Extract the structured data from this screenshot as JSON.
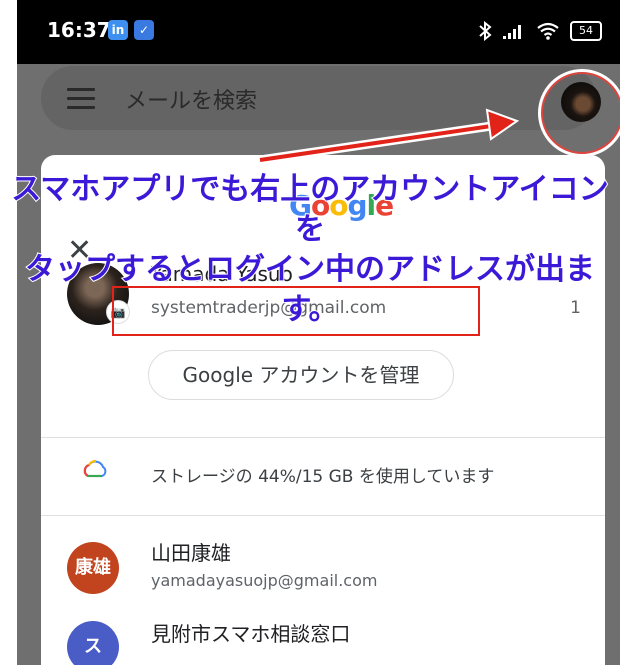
{
  "status_bar": {
    "time": "16:37",
    "battery": "54"
  },
  "search": {
    "placeholder": "メールを検索"
  },
  "account_card": {
    "google_logo": "Google",
    "close_label": "✕",
    "current_user": {
      "name": "Yamada Yasuo",
      "email": "systemtraderjp@gmail.com",
      "count": "1"
    },
    "manage_button_label": "Google アカウントを管理",
    "storage_text": "ストレージの 44%/15 GB を使用しています",
    "other_accounts": [
      {
        "avatar_text": "康雄",
        "name": "山田康雄",
        "email": "yamadayasuojp@gmail.com",
        "avatar_color": "#c1441f"
      },
      {
        "avatar_text": "ス",
        "name": "見附市スマホ相談窓口",
        "avatar_color": "#4a5cc5"
      }
    ]
  },
  "annotation": {
    "line1": "スマホアプリでも右上のアカウントアイコンを",
    "line2": "タップするとログイン中のアドレスが出ます。"
  },
  "colors": {
    "annotation_text": "#3b19d6",
    "highlight_red": "#e2231a"
  },
  "icons": {
    "menu": "hamburger-icon",
    "cloud": "cloud-icon",
    "camera": "camera-icon"
  }
}
